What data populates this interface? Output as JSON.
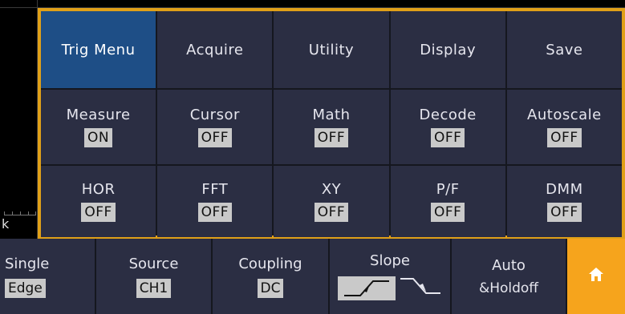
{
  "menu": {
    "row1": [
      {
        "label": "Trig Menu",
        "selected": true
      },
      {
        "label": "Acquire"
      },
      {
        "label": "Utility"
      },
      {
        "label": "Display"
      },
      {
        "label": "Save"
      }
    ],
    "row2": [
      {
        "label": "Measure",
        "state": "ON"
      },
      {
        "label": "Cursor",
        "state": "OFF"
      },
      {
        "label": "Math",
        "state": "OFF"
      },
      {
        "label": "Decode",
        "state": "OFF"
      },
      {
        "label": "Autoscale",
        "state": "OFF"
      }
    ],
    "row3": [
      {
        "label": "HOR",
        "state": "OFF"
      },
      {
        "label": "FFT",
        "state": "OFF"
      },
      {
        "label": "XY",
        "state": "OFF"
      },
      {
        "label": "P/F",
        "state": "OFF"
      },
      {
        "label": "DMM",
        "state": "OFF"
      }
    ]
  },
  "bottom": {
    "single": {
      "label": "Single",
      "value": "Edge"
    },
    "source": {
      "label": "Source",
      "value": "CH1"
    },
    "coupling": {
      "label": "Coupling",
      "value": "DC"
    },
    "slope": {
      "label": "Slope"
    },
    "auto": {
      "label": "Auto",
      "value": "&Holdoff"
    },
    "home_icon": "home-icon"
  },
  "corner_text": "k",
  "colors": {
    "panel_bg": "#2b2e43",
    "selected_bg": "#1e4e86",
    "accent_border": "#e0a018",
    "home_bg": "#f6a41c",
    "state_bg": "#c9c9c9"
  }
}
